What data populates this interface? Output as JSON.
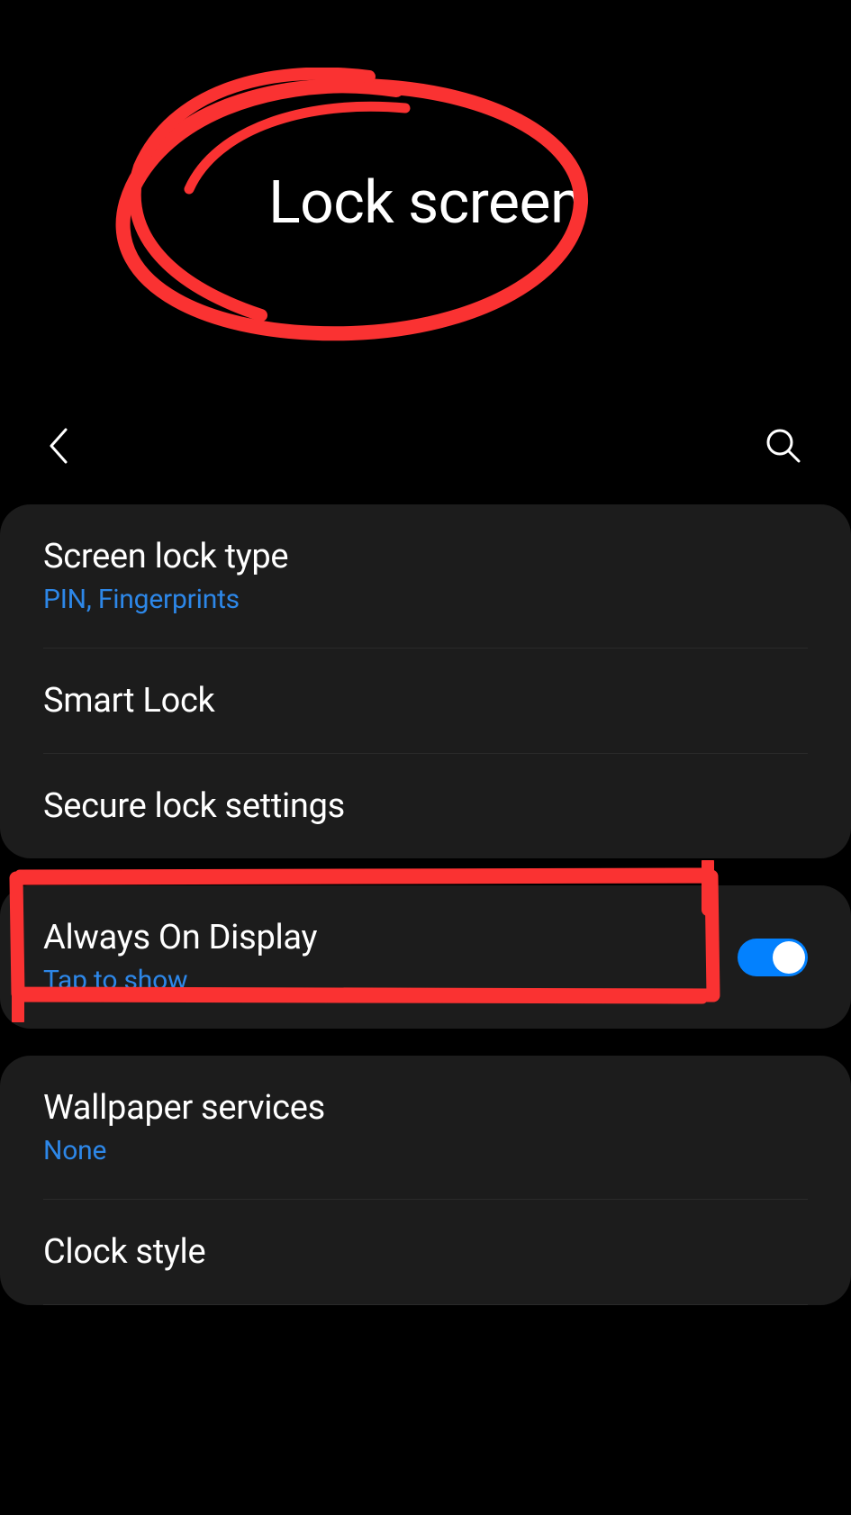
{
  "header": {
    "title": "Lock screen"
  },
  "sections": [
    {
      "rows": [
        {
          "title": "Screen lock type",
          "subtitle": "PIN, Fingerprints",
          "subtitle_accent": true
        },
        {
          "title": "Smart Lock"
        },
        {
          "title": "Secure lock settings"
        }
      ]
    },
    {
      "rows": [
        {
          "title": "Always On Display",
          "subtitle": "Tap to show",
          "subtitle_accent": true,
          "toggle": true
        }
      ]
    },
    {
      "rows": [
        {
          "title": "Wallpaper services",
          "subtitle": "None",
          "subtitle_accent": true
        },
        {
          "title": "Clock style"
        }
      ]
    }
  ],
  "annotations": {
    "circle_color": "#fa3232",
    "rect_color": "#fa3232"
  }
}
